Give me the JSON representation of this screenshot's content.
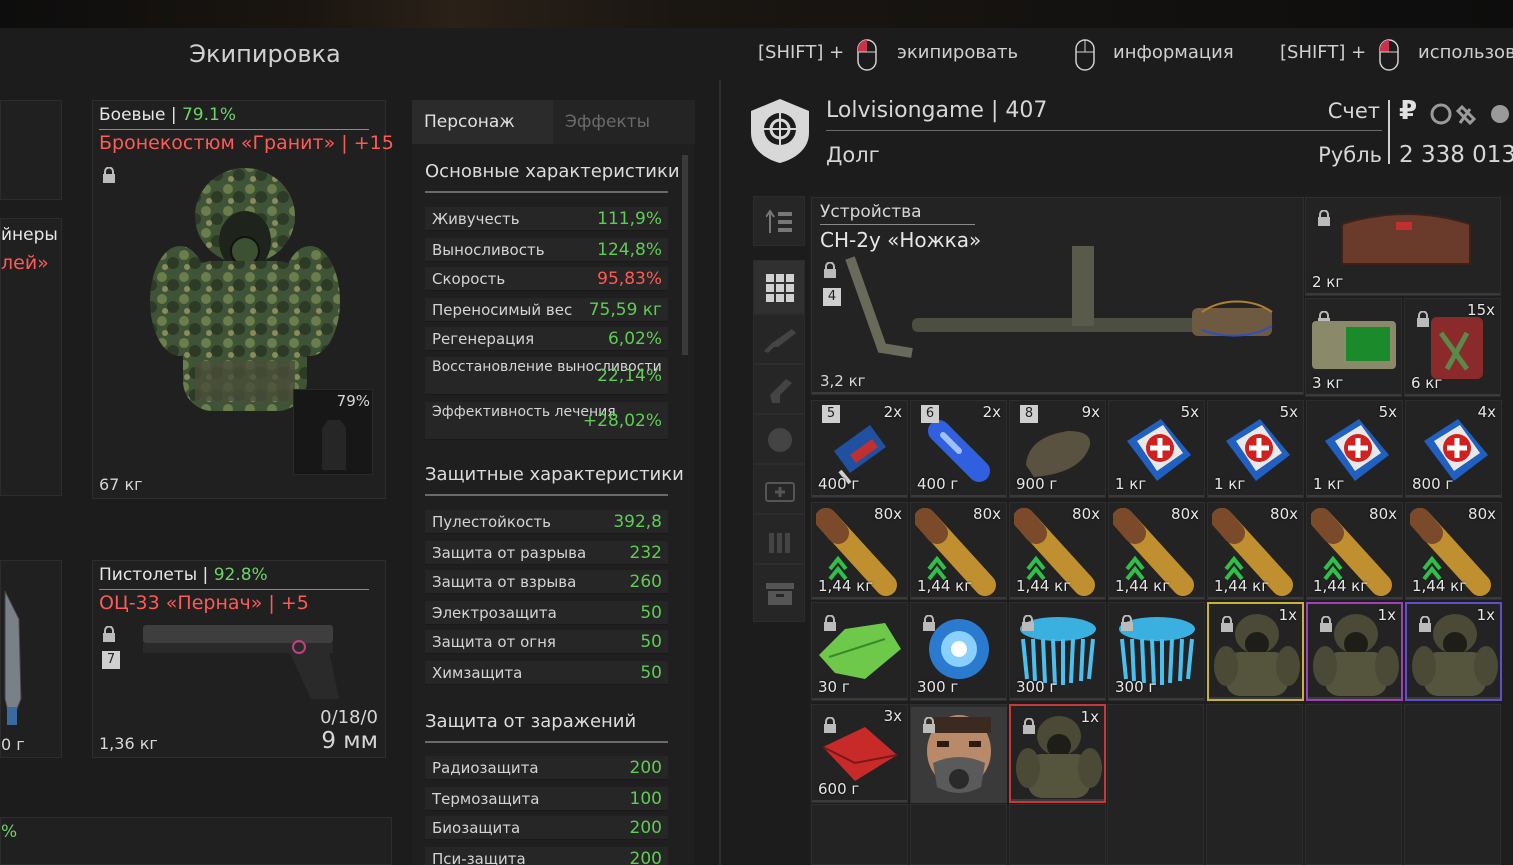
{
  "equipment": {
    "title": "Экипировка",
    "combat": {
      "category": "Боевые",
      "condition": "79.1%",
      "name": "Бронекостюм «Гранит»",
      "upgrade": "+15",
      "weight": "67 кг",
      "slot_condition": "79%"
    },
    "pistols": {
      "category": "Пистолеты",
      "condition": "92.8%",
      "name": "ОЦ-33 «Пернач»",
      "upgrade": "+5",
      "badge": "7",
      "weight": "1,36 кг",
      "ammo": "0/18/0",
      "caliber": "9 мм"
    },
    "partial_left": {
      "line1": "йнеры",
      "line2": "лей»",
      "weight_fragment": "0 г",
      "pct_fragment": "%"
    }
  },
  "stats": {
    "tabs": [
      "Персонаж",
      "Эффекты"
    ],
    "main_title": "Основные характеристики",
    "main": [
      {
        "label": "Живучесть",
        "value": "111,9%",
        "color": "green"
      },
      {
        "label": "Выносливость",
        "value": "124,8%",
        "color": "green"
      },
      {
        "label": "Скорость",
        "value": "95,83%",
        "color": "red"
      },
      {
        "label": "Переносимый вес",
        "value": "75,59 кг",
        "color": "green"
      },
      {
        "label": "Регенерация",
        "value": "6,02%",
        "color": "green"
      },
      {
        "label": "Восстановление выносливости",
        "value": "22,14%",
        "color": "green"
      },
      {
        "label": "Эффективность лечения",
        "value": "+28,02%",
        "color": "green"
      }
    ],
    "protect_title": "Защитные характеристики",
    "protect": [
      {
        "label": "Пулестойкость",
        "value": "392,8"
      },
      {
        "label": "Защита от разрыва",
        "value": "232"
      },
      {
        "label": "Защита от взрыва",
        "value": "260"
      },
      {
        "label": "Электрозащита",
        "value": "50"
      },
      {
        "label": "Защита от огня",
        "value": "50"
      },
      {
        "label": "Химзащита",
        "value": "50"
      }
    ],
    "contam_title": "Защита от заражений",
    "contam": [
      {
        "label": "Радиозащита",
        "value": "200"
      },
      {
        "label": "Термозащита",
        "value": "100"
      },
      {
        "label": "Биозащита",
        "value": "200"
      },
      {
        "label": "Пси-защита",
        "value": "200"
      }
    ]
  },
  "controls": [
    {
      "prefix": "[SHIFT] +",
      "action": "экипировать"
    },
    {
      "prefix": "",
      "action": "информация"
    },
    {
      "prefix": "[SHIFT] +",
      "action": "использов"
    }
  ],
  "player": {
    "name": "Lolvisiongame",
    "level": "407",
    "debt_label": "Долг",
    "account_label": "Счет",
    "currency_label": "Рубль",
    "balance": "2 338 013",
    "currency_symbol": "₽"
  },
  "inventory": {
    "featured": {
      "category": "Устройства",
      "name": "СН-2у «Ножка»",
      "badge": "4",
      "weight": "3,2 кг"
    },
    "top_right": [
      {
        "weight": "2 кг",
        "count": "",
        "icon": "chest-icon"
      },
      {
        "weight": "3 кг",
        "count": "",
        "icon": "pda-icon"
      },
      {
        "weight": "6 кг",
        "count": "15x",
        "icon": "can-icon"
      }
    ],
    "row_meds": [
      {
        "badge": "5",
        "count": "2x",
        "weight": "400 г",
        "icon": "syringe-icon"
      },
      {
        "badge": "6",
        "count": "2x",
        "weight": "400 г",
        "icon": "blue-tube-icon"
      },
      {
        "badge": "8",
        "count": "9x",
        "weight": "900 г",
        "icon": "bandage-icon"
      },
      {
        "badge": "",
        "count": "5x",
        "weight": "1 кг",
        "icon": "medkit-icon"
      },
      {
        "badge": "",
        "count": "5x",
        "weight": "1 кг",
        "icon": "medkit-icon"
      },
      {
        "badge": "",
        "count": "5x",
        "weight": "1 кг",
        "icon": "medkit-icon"
      },
      {
        "badge": "",
        "count": "4x",
        "weight": "800 г",
        "icon": "medkit-icon"
      }
    ],
    "row_ammo": [
      {
        "count": "80x",
        "weight": "1,44 кг"
      },
      {
        "count": "80x",
        "weight": "1,44 кг"
      },
      {
        "count": "80x",
        "weight": "1,44 кг"
      },
      {
        "count": "80x",
        "weight": "1,44 кг"
      },
      {
        "count": "80x",
        "weight": "1,44 кг"
      },
      {
        "count": "80x",
        "weight": "1,44 кг"
      },
      {
        "count": "80x",
        "weight": "1,44 кг"
      }
    ],
    "row_artifacts": [
      {
        "count": "",
        "weight": "30 г",
        "icon": "leaf-artifact-icon"
      },
      {
        "count": "",
        "weight": "300 г",
        "icon": "energy-artifact-icon"
      },
      {
        "count": "",
        "weight": "300 г",
        "icon": "crystal-artifact-icon"
      },
      {
        "count": "",
        "weight": "300 г",
        "icon": "crystal-artifact-icon"
      },
      {
        "count": "1x",
        "weight": "",
        "icon": "armor-icon",
        "border": "#c9b13a"
      },
      {
        "count": "1x",
        "weight": "",
        "icon": "armor-icon",
        "border": "#a040b8"
      },
      {
        "count": "1x",
        "weight": "",
        "icon": "armor-icon",
        "border": "#6050c8"
      }
    ],
    "row_last": [
      {
        "count": "3x",
        "weight": "600 г",
        "icon": "red-case-icon"
      },
      {
        "count": "",
        "weight": "",
        "icon": "gasmask-face-icon"
      },
      {
        "count": "1x",
        "weight": "",
        "icon": "armor-icon",
        "border": "#c83838"
      }
    ]
  }
}
